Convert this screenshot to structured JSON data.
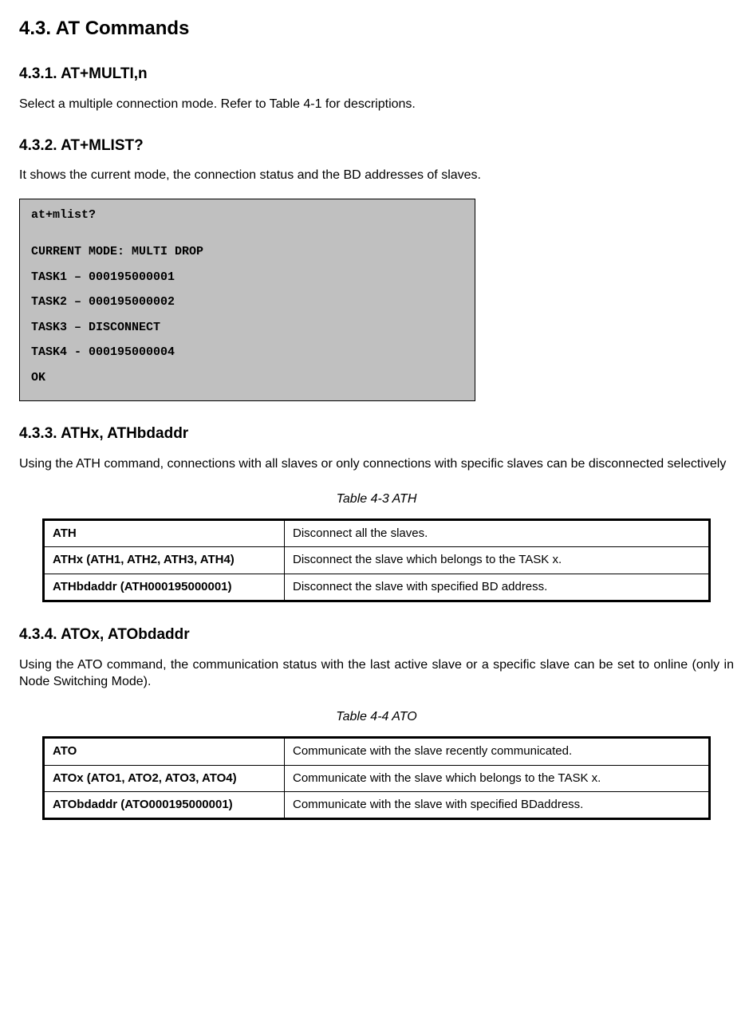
{
  "h1": "4.3. AT Commands",
  "s1": {
    "title": "4.3.1. AT+MULTI,n",
    "text": "Select a multiple connection mode. Refer to Table 4-1 for descriptions."
  },
  "s2": {
    "title": "4.3.2. AT+MLIST?",
    "text": "It shows the current mode, the connection status and the BD addresses of slaves.",
    "code": {
      "l0": "at+mlist?",
      "l1": "CURRENT MODE: MULTI DROP",
      "l2": "TASK1 – 000195000001",
      "l3": "TASK2 – 000195000002",
      "l4": "TASK3 – DISCONNECT",
      "l5": "TASK4 - 000195000004",
      "l6": "OK"
    }
  },
  "s3": {
    "title": "4.3.3. ATHx, ATHbdaddr",
    "text": "Using the ATH command, connections with all slaves or only connections with specific slaves can be disconnected selectively",
    "caption": "Table 4-3 ATH",
    "rows": [
      {
        "cmd": "ATH",
        "desc": "Disconnect all the slaves."
      },
      {
        "cmd": "ATHx (ATH1, ATH2, ATH3, ATH4)",
        "desc": "Disconnect the slave which belongs to the TASK x."
      },
      {
        "cmd": "ATHbdaddr (ATH000195000001)",
        "desc": "Disconnect the slave with specified BD address."
      }
    ]
  },
  "s4": {
    "title": "4.3.4. ATOx, ATObdaddr",
    "text": "Using the ATO command, the communication status with the last active slave or a specific slave can be set to online (only in Node Switching Mode).",
    "caption": "Table 4-4 ATO",
    "rows": [
      {
        "cmd": "ATO",
        "desc": "Communicate with the slave recently communicated."
      },
      {
        "cmd": "ATOx (ATO1, ATO2, ATO3, ATO4)",
        "desc": "Communicate with the slave which belongs to the TASK x."
      },
      {
        "cmd": "ATObdaddr (ATO000195000001)",
        "desc": "Communicate with the slave with specified BDaddress."
      }
    ]
  }
}
